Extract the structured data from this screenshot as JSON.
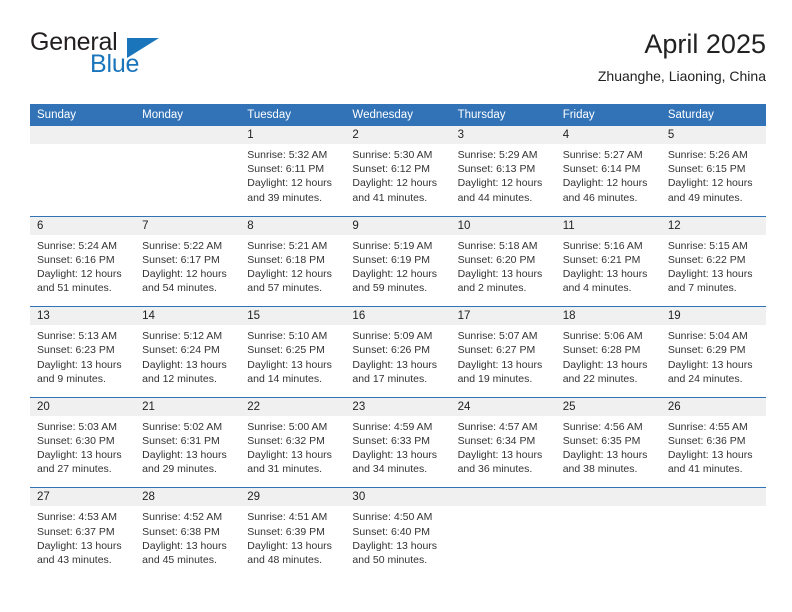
{
  "brand": {
    "word_one": "General",
    "word_two": "Blue",
    "triangle": "triangle-logo-mark"
  },
  "header": {
    "title": "April 2025",
    "location": "Zhuanghe, Liaoning, China"
  },
  "calendar": {
    "weekday_headers": [
      "Sunday",
      "Monday",
      "Tuesday",
      "Wednesday",
      "Thursday",
      "Friday",
      "Saturday"
    ],
    "colors": {
      "header_blue": "#3273b7",
      "day_band_gray": "#f0f0f0",
      "brand_blue": "#1b75bb",
      "text": "#222222"
    },
    "labels": {
      "sunrise_prefix": "Sunrise:",
      "sunset_prefix": "Sunset:",
      "daylight_prefix": "Daylight:"
    },
    "weeks": [
      [
        {
          "empty": true
        },
        {
          "empty": true
        },
        {
          "day": "1",
          "sunrise": "Sunrise: 5:32 AM",
          "sunset": "Sunset: 6:11 PM",
          "daylight": "Daylight: 12 hours and 39 minutes."
        },
        {
          "day": "2",
          "sunrise": "Sunrise: 5:30 AM",
          "sunset": "Sunset: 6:12 PM",
          "daylight": "Daylight: 12 hours and 41 minutes."
        },
        {
          "day": "3",
          "sunrise": "Sunrise: 5:29 AM",
          "sunset": "Sunset: 6:13 PM",
          "daylight": "Daylight: 12 hours and 44 minutes."
        },
        {
          "day": "4",
          "sunrise": "Sunrise: 5:27 AM",
          "sunset": "Sunset: 6:14 PM",
          "daylight": "Daylight: 12 hours and 46 minutes."
        },
        {
          "day": "5",
          "sunrise": "Sunrise: 5:26 AM",
          "sunset": "Sunset: 6:15 PM",
          "daylight": "Daylight: 12 hours and 49 minutes."
        }
      ],
      [
        {
          "day": "6",
          "sunrise": "Sunrise: 5:24 AM",
          "sunset": "Sunset: 6:16 PM",
          "daylight": "Daylight: 12 hours and 51 minutes."
        },
        {
          "day": "7",
          "sunrise": "Sunrise: 5:22 AM",
          "sunset": "Sunset: 6:17 PM",
          "daylight": "Daylight: 12 hours and 54 minutes."
        },
        {
          "day": "8",
          "sunrise": "Sunrise: 5:21 AM",
          "sunset": "Sunset: 6:18 PM",
          "daylight": "Daylight: 12 hours and 57 minutes."
        },
        {
          "day": "9",
          "sunrise": "Sunrise: 5:19 AM",
          "sunset": "Sunset: 6:19 PM",
          "daylight": "Daylight: 12 hours and 59 minutes."
        },
        {
          "day": "10",
          "sunrise": "Sunrise: 5:18 AM",
          "sunset": "Sunset: 6:20 PM",
          "daylight": "Daylight: 13 hours and 2 minutes."
        },
        {
          "day": "11",
          "sunrise": "Sunrise: 5:16 AM",
          "sunset": "Sunset: 6:21 PM",
          "daylight": "Daylight: 13 hours and 4 minutes."
        },
        {
          "day": "12",
          "sunrise": "Sunrise: 5:15 AM",
          "sunset": "Sunset: 6:22 PM",
          "daylight": "Daylight: 13 hours and 7 minutes."
        }
      ],
      [
        {
          "day": "13",
          "sunrise": "Sunrise: 5:13 AM",
          "sunset": "Sunset: 6:23 PM",
          "daylight": "Daylight: 13 hours and 9 minutes."
        },
        {
          "day": "14",
          "sunrise": "Sunrise: 5:12 AM",
          "sunset": "Sunset: 6:24 PM",
          "daylight": "Daylight: 13 hours and 12 minutes."
        },
        {
          "day": "15",
          "sunrise": "Sunrise: 5:10 AM",
          "sunset": "Sunset: 6:25 PM",
          "daylight": "Daylight: 13 hours and 14 minutes."
        },
        {
          "day": "16",
          "sunrise": "Sunrise: 5:09 AM",
          "sunset": "Sunset: 6:26 PM",
          "daylight": "Daylight: 13 hours and 17 minutes."
        },
        {
          "day": "17",
          "sunrise": "Sunrise: 5:07 AM",
          "sunset": "Sunset: 6:27 PM",
          "daylight": "Daylight: 13 hours and 19 minutes."
        },
        {
          "day": "18",
          "sunrise": "Sunrise: 5:06 AM",
          "sunset": "Sunset: 6:28 PM",
          "daylight": "Daylight: 13 hours and 22 minutes."
        },
        {
          "day": "19",
          "sunrise": "Sunrise: 5:04 AM",
          "sunset": "Sunset: 6:29 PM",
          "daylight": "Daylight: 13 hours and 24 minutes."
        }
      ],
      [
        {
          "day": "20",
          "sunrise": "Sunrise: 5:03 AM",
          "sunset": "Sunset: 6:30 PM",
          "daylight": "Daylight: 13 hours and 27 minutes."
        },
        {
          "day": "21",
          "sunrise": "Sunrise: 5:02 AM",
          "sunset": "Sunset: 6:31 PM",
          "daylight": "Daylight: 13 hours and 29 minutes."
        },
        {
          "day": "22",
          "sunrise": "Sunrise: 5:00 AM",
          "sunset": "Sunset: 6:32 PM",
          "daylight": "Daylight: 13 hours and 31 minutes."
        },
        {
          "day": "23",
          "sunrise": "Sunrise: 4:59 AM",
          "sunset": "Sunset: 6:33 PM",
          "daylight": "Daylight: 13 hours and 34 minutes."
        },
        {
          "day": "24",
          "sunrise": "Sunrise: 4:57 AM",
          "sunset": "Sunset: 6:34 PM",
          "daylight": "Daylight: 13 hours and 36 minutes."
        },
        {
          "day": "25",
          "sunrise": "Sunrise: 4:56 AM",
          "sunset": "Sunset: 6:35 PM",
          "daylight": "Daylight: 13 hours and 38 minutes."
        },
        {
          "day": "26",
          "sunrise": "Sunrise: 4:55 AM",
          "sunset": "Sunset: 6:36 PM",
          "daylight": "Daylight: 13 hours and 41 minutes."
        }
      ],
      [
        {
          "day": "27",
          "sunrise": "Sunrise: 4:53 AM",
          "sunset": "Sunset: 6:37 PM",
          "daylight": "Daylight: 13 hours and 43 minutes."
        },
        {
          "day": "28",
          "sunrise": "Sunrise: 4:52 AM",
          "sunset": "Sunset: 6:38 PM",
          "daylight": "Daylight: 13 hours and 45 minutes."
        },
        {
          "day": "29",
          "sunrise": "Sunrise: 4:51 AM",
          "sunset": "Sunset: 6:39 PM",
          "daylight": "Daylight: 13 hours and 48 minutes."
        },
        {
          "day": "30",
          "sunrise": "Sunrise: 4:50 AM",
          "sunset": "Sunset: 6:40 PM",
          "daylight": "Daylight: 13 hours and 50 minutes."
        },
        {
          "empty": true
        },
        {
          "empty": true
        },
        {
          "empty": true
        }
      ]
    ]
  }
}
